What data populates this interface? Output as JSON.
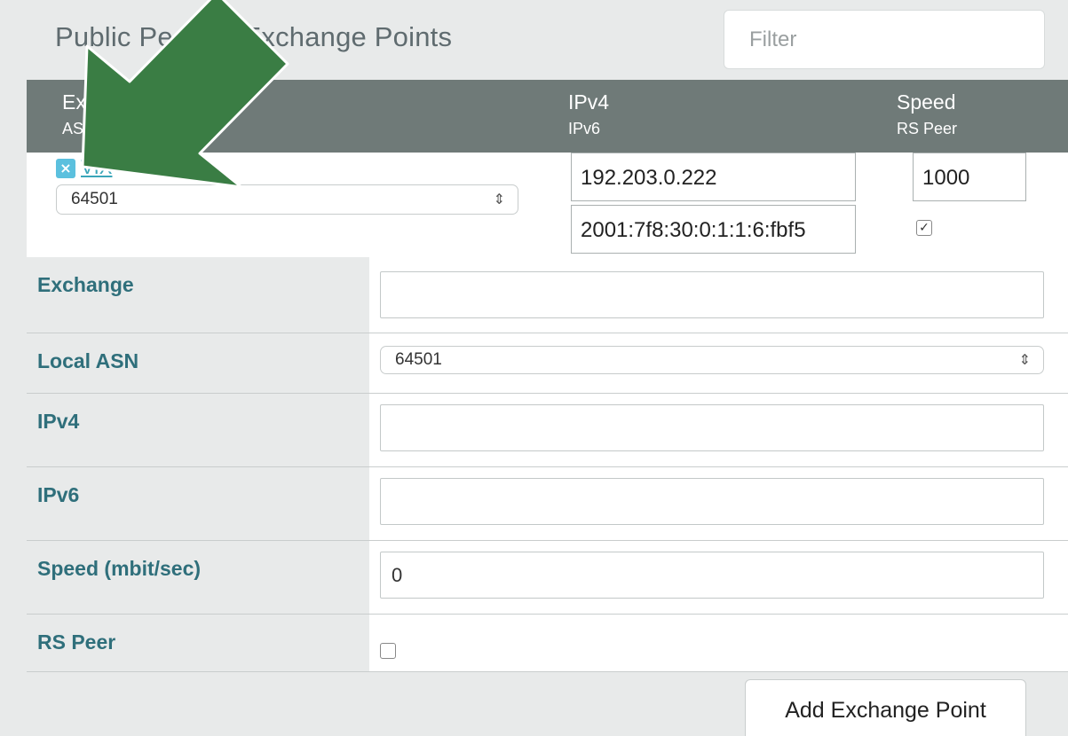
{
  "panel": {
    "title": "Public Peering Exchange Points",
    "filter_placeholder": "Filter"
  },
  "table_header": {
    "col1_line1": "Exchange",
    "col1_line2": "ASN",
    "col2_line1": "IPv4",
    "col2_line2": "IPv6",
    "col3_line1": "Speed",
    "col3_line2": "RS Peer"
  },
  "row": {
    "remove_icon": "×",
    "exchange_link": "VIX",
    "asn_value": "64501",
    "ipv4_value": "192.203.0.222",
    "ipv6_value": "2001:7f8:30:0:1:1:6:fbf5",
    "speed_value": "1000",
    "rs_peer_checked": true
  },
  "form": {
    "exchange_label": "Exchange",
    "exchange_value": "",
    "local_asn_label": "Local ASN",
    "local_asn_value": "64501",
    "ipv4_label": "IPv4",
    "ipv4_value": "",
    "ipv6_label": "IPv6",
    "ipv6_value": "",
    "speed_label": "Speed (mbit/sec)",
    "speed_value": "0",
    "rs_peer_label": "RS Peer",
    "rs_peer_checked": false
  },
  "buttons": {
    "add_label": "Add Exchange Point"
  },
  "icons": {
    "select_arrows": "⇕",
    "checkmark": "✓",
    "annotation": "green-arrow-icon"
  },
  "colors": {
    "header_bg": "#6f7a78",
    "label_color": "#2f6f7b",
    "link_color": "#3aa6b9",
    "remove_icon_bg": "#5bc0de",
    "arrow_fill": "#3a7d44"
  }
}
